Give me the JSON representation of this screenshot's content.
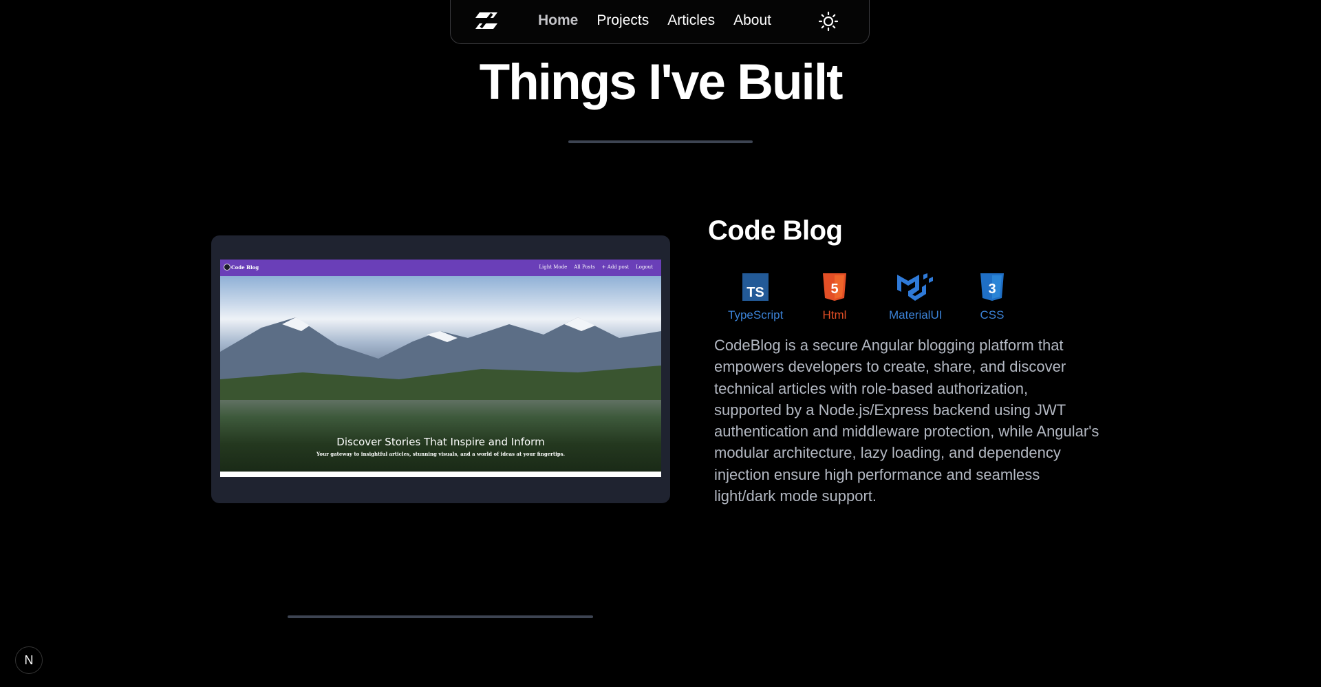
{
  "nav": {
    "logo_icon": "logo-icon",
    "links": [
      {
        "label": "Home",
        "active": true
      },
      {
        "label": "Projects",
        "active": false
      },
      {
        "label": "Articles",
        "active": false
      },
      {
        "label": "About",
        "active": false
      }
    ],
    "theme_icon": "sun-icon"
  },
  "page": {
    "title": "Things I've Built"
  },
  "project": {
    "title": "Code Blog",
    "screenshot": {
      "brand": "Code Blog",
      "menu": [
        "Light Mode",
        "All Posts",
        "+ Add post",
        "Logout"
      ],
      "headline": "Discover Stories That Inspire and Inform",
      "subline": "Your gateway to insightful articles, stunning visuals, and a world of ideas at your fingertips."
    },
    "tech": [
      {
        "label": "TypeScript",
        "icon": "typescript-icon",
        "color": "#3178c6"
      },
      {
        "label": "Html",
        "icon": "html5-icon",
        "color": "#e34f26"
      },
      {
        "label": "MaterialUI",
        "icon": "materialui-icon",
        "color": "#2f7ad8"
      },
      {
        "label": "CSS",
        "icon": "css3-icon",
        "color": "#2f7ad8"
      }
    ],
    "description": "CodeBlog is a secure Angular blogging platform that empowers developers to create, share, and discover technical articles with role-based authorization, supported by a Node.js/Express backend using JWT authentication and middleware protection, while Angular's modular architecture, lazy loading, and dependency injection ensure high performance and seamless light/dark mode support."
  },
  "badge": {
    "label": "N"
  }
}
